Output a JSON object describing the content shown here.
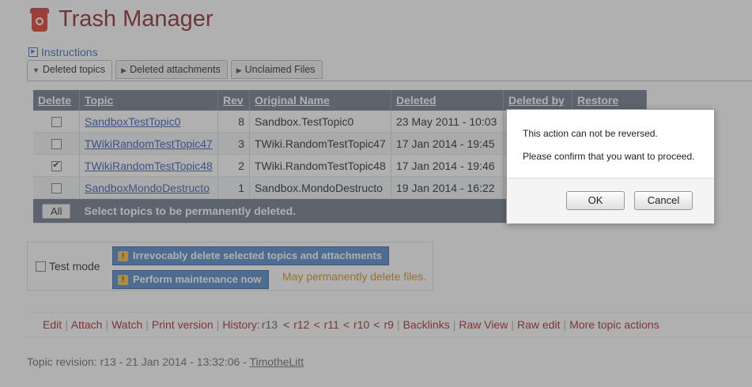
{
  "page": {
    "title": "Trash Manager",
    "instructions_label": "Instructions"
  },
  "tabs": [
    {
      "label": "Deleted topics",
      "active": true
    },
    {
      "label": "Deleted attachments",
      "active": false
    },
    {
      "label": "Unclaimed Files",
      "active": false
    }
  ],
  "table": {
    "headers": {
      "delete": "Delete",
      "topic": "Topic",
      "rev": "Rev",
      "original_name": "Original Name",
      "deleted": "Deleted",
      "deleted_by": "Deleted by",
      "restore": "Restore"
    },
    "rows": [
      {
        "checked": false,
        "topic": "SandboxTestTopic0",
        "rev": "8",
        "original_name": "Sandbox.TestTopic0",
        "deleted": "23 May 2011 - 10:03"
      },
      {
        "checked": false,
        "topic": "TWikiRandomTestTopic47",
        "rev": "3",
        "original_name": "TWiki.RandomTestTopic47",
        "deleted": "17 Jan 2014 - 19:45"
      },
      {
        "checked": true,
        "topic": "TWikiRandomTestTopic48",
        "rev": "2",
        "original_name": "TWiki.RandomTestTopic48",
        "deleted": "17 Jan 2014 - 19:46"
      },
      {
        "checked": false,
        "topic": "SandboxMondoDestructo",
        "rev": "1",
        "original_name": "Sandbox.MondoDestructo",
        "deleted": "19 Jan 2014 - 16:22"
      }
    ],
    "all_button": "All",
    "footer_text": "Select topics to be permanently deleted."
  },
  "operations": {
    "test_mode_label": "Test mode",
    "delete_button": "Irrevocably delete selected topics and attachments",
    "maintenance_button": "Perform maintenance now",
    "maintenance_warning": "May permanently delete files."
  },
  "topic_actions": {
    "edit": "Edit",
    "attach": "Attach",
    "watch": "Watch",
    "print_version": "Print version",
    "history": "History",
    "current_rev": "r13",
    "revs": [
      "r12",
      "r11",
      "r10",
      "r9"
    ],
    "backlinks": "Backlinks",
    "raw_view": "Raw View",
    "raw_edit": "Raw edit",
    "more_actions": "More topic actions"
  },
  "revision_info": {
    "text": "Topic revision: r13 - 21 Jan 2014 - 13:32:06 - ",
    "author": "TimotheLitt"
  },
  "dialog": {
    "message1": "This action can not be reversed.",
    "message2": "Please confirm that you want to proceed.",
    "ok_label": "OK",
    "cancel_label": "Cancel"
  },
  "colors": {
    "title": "#882222",
    "table_header": "#687585",
    "link": "#3355aa",
    "action_link": "#a02222",
    "warning": "#d08a20",
    "button_blue": "#4a86c6"
  }
}
